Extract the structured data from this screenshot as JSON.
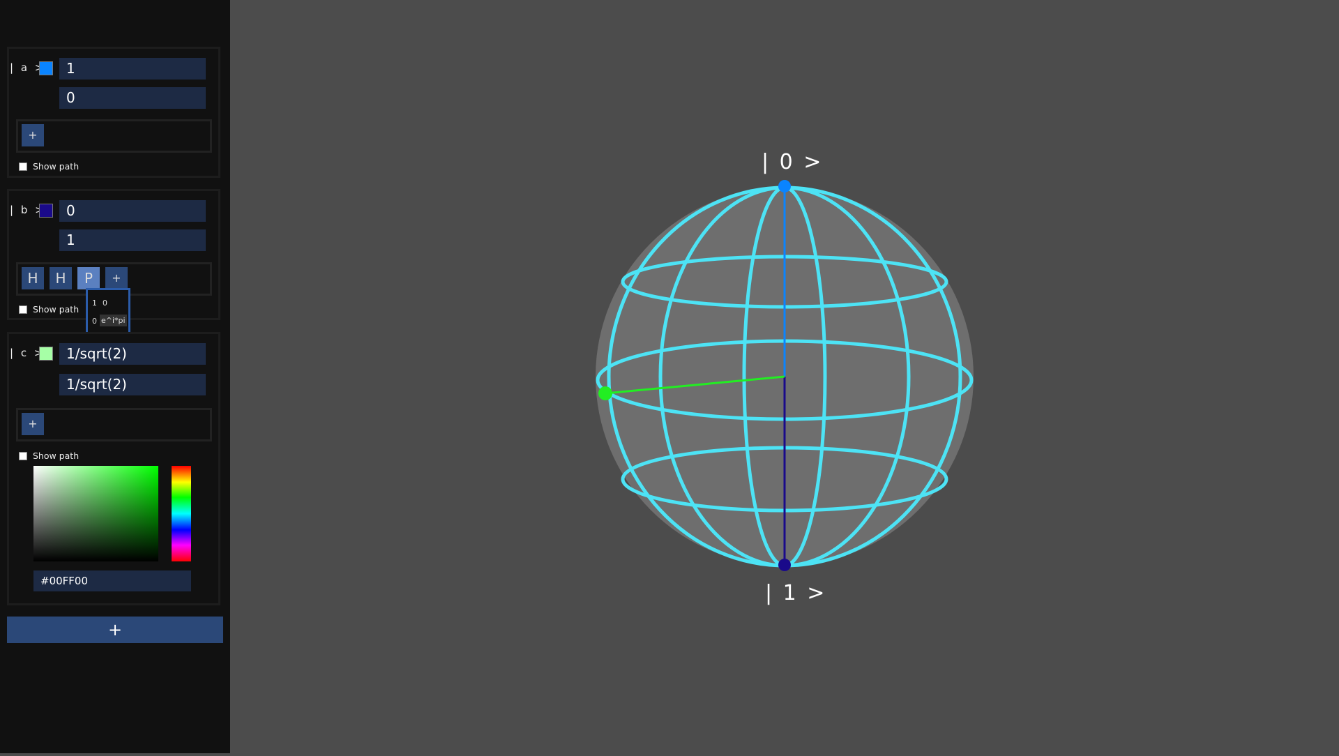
{
  "sidebar": {
    "qubits": [
      {
        "ket": "| a >",
        "color": "#0a84ff",
        "amp0": "1",
        "amp1": "0",
        "gates": [],
        "add_gate": "+",
        "show_path": "Show path"
      },
      {
        "ket": "| b >",
        "color": "#1a0a8a",
        "amp0": "0",
        "amp1": "1",
        "gates": [
          "H",
          "H",
          "P"
        ],
        "add_gate": "+",
        "show_path": "Show path"
      },
      {
        "ket": "| c >",
        "color": "#a6ffa6",
        "amp0": "1/sqrt(2)",
        "amp1": "1/sqrt(2)",
        "gates": [],
        "add_gate": "+",
        "show_path": "Show path"
      }
    ],
    "gate_popup": {
      "r1c1": "1",
      "r1c2": "0",
      "r2c1": "0",
      "r2c2": "e^i*pi"
    },
    "color_picker": {
      "hex": "#00FF00",
      "hue_color": "#00FF00"
    },
    "add_qubit": "+"
  },
  "sphere": {
    "label_top": "| 0 >",
    "label_bottom": "| 1 >",
    "grid_color": "#4de3f5",
    "sphere_fill": "#6e6e6e",
    "states": [
      {
        "name": "a",
        "color": "#0a84ff"
      },
      {
        "name": "b",
        "color": "#1a0a8a"
      },
      {
        "name": "c",
        "color": "#22ee22"
      }
    ]
  }
}
